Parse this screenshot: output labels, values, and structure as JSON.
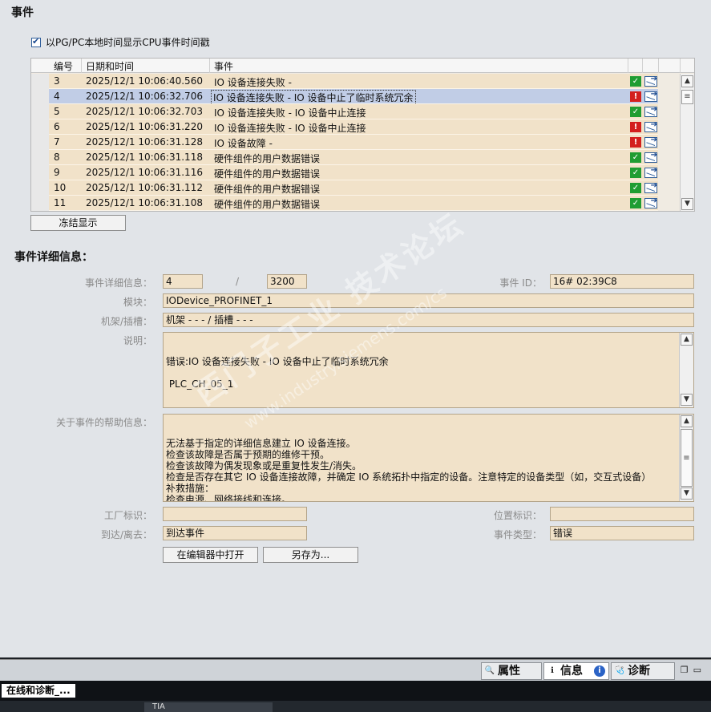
{
  "events": {
    "title": "事件",
    "checkbox_label": "以PG/PC本地时间显示CPU事件时间戳",
    "columns": {
      "no": "编号",
      "datetime": "日期和时间",
      "event": "事件"
    },
    "rows": [
      {
        "no": "3",
        "datetime": "2025/12/1 10:06:40.560",
        "event": "IO 设备连接失败 -",
        "status": "ok"
      },
      {
        "no": "4",
        "datetime": "2025/12/1 10:06:32.706",
        "event": "IO 设备连接失败 - IO 设备中止了临时系统冗余",
        "status": "error",
        "selected": true
      },
      {
        "no": "5",
        "datetime": "2025/12/1 10:06:32.703",
        "event": "IO 设备连接失败 - IO 设备中止连接",
        "status": "ok"
      },
      {
        "no": "6",
        "datetime": "2025/12/1 10:06:31.220",
        "event": "IO 设备连接失败 - IO 设备中止连接",
        "status": "error"
      },
      {
        "no": "7",
        "datetime": "2025/12/1 10:06:31.128",
        "event": "IO 设备故障 -",
        "status": "error"
      },
      {
        "no": "8",
        "datetime": "2025/12/1 10:06:31.118",
        "event": "硬件组件的用户数据错误",
        "status": "ok"
      },
      {
        "no": "9",
        "datetime": "2025/12/1 10:06:31.116",
        "event": "硬件组件的用户数据错误",
        "status": "ok"
      },
      {
        "no": "10",
        "datetime": "2025/12/1 10:06:31.112",
        "event": "硬件组件的用户数据错误",
        "status": "ok"
      },
      {
        "no": "11",
        "datetime": "2025/12/1 10:06:31.108",
        "event": "硬件组件的用户数据错误",
        "status": "ok"
      }
    ],
    "freeze_button": "冻结显示"
  },
  "details": {
    "title": "事件详细信息：",
    "detail_label": "事件详细信息：",
    "detail_value1": "4",
    "detail_sep": "/",
    "detail_value2": "3200",
    "event_id_label": "事件 ID：",
    "event_id_value": "16# 02:39C8",
    "module_label": "模块：",
    "module_value": "IODevice_PROFINET_1",
    "rack_label": "机架/插槽：",
    "rack_value": "机架 - - - / 插槽 - - -",
    "desc_label": "说明：",
    "desc_value": "错误:IO 设备连接失败 - IO 设备中止了临时系统冗余\n\n PLC_CH_05_1",
    "help_label": "关于事件的帮助信息：",
    "help_value": "无法基于指定的详细信息建立 IO 设备连接。\n检查该故障是否属于预期的维修干预。\n检查该故障为偶发现象或是重复性发生/消失。\n检查是否存在其它 IO 设备连接故障，并确定 IO 系统拓扑中指定的设备。注意特定的设备类型（如，交互式设备）\n补救措施：\n检查电源、网络接线和连接。\n 固件错误：请联系客户技术支持寻求帮助。",
    "plant_label": "工厂标识：",
    "plant_value": "",
    "location_label": "位置标识：",
    "location_value": "",
    "arrival_label": "到达/离去：",
    "arrival_value": "到达事件",
    "type_label": "事件类型：",
    "type_value": "错误",
    "open_editor_button": "在编辑器中打开",
    "save_as_button": "另存为..."
  },
  "watermark": {
    "line1": "西门子工业  技术论坛",
    "line2": "www.industry.siemens.com/cs"
  },
  "bottom": {
    "tabs": [
      {
        "label": "属性",
        "icon": "properties-icon"
      },
      {
        "label": "信息",
        "icon": "info-icon"
      },
      {
        "label": "诊断",
        "icon": "diagnostics-icon"
      }
    ],
    "task_label": "在线和诊断_...",
    "tia_label": "TIA"
  },
  "colors": {
    "row_bg": "#f1e2c9",
    "row_selected": "#c1cde6",
    "ok": "#1f9d32",
    "error": "#d3201e"
  }
}
